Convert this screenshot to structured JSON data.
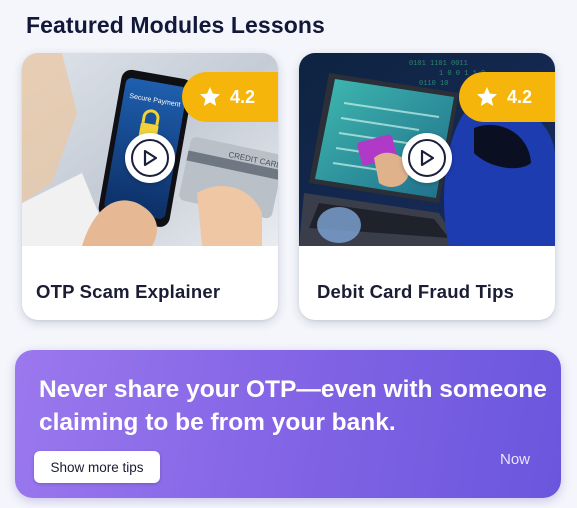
{
  "section": {
    "title": "Featured Modules Lessons"
  },
  "cards": [
    {
      "title": "OTP Scam Explainer",
      "rating": "4.2",
      "thumb_icon": "phone-secure-payment-image",
      "play_icon": "play-icon",
      "rating_icon": "star-icon"
    },
    {
      "title": "Debit Card Fraud Tips",
      "rating": "4.2",
      "thumb_icon": "hacker-laptop-image",
      "play_icon": "play-icon",
      "rating_icon": "star-icon"
    }
  ],
  "tip": {
    "text": "Never share your OTP—even with someone claiming to be from your bank.",
    "button_label": "Show more tips",
    "time": "Now"
  },
  "colors": {
    "title": "#12183a",
    "rating_badge": "#f5b50a",
    "banner_start": "#9b78ee",
    "banner_end": "#6a56dd"
  }
}
